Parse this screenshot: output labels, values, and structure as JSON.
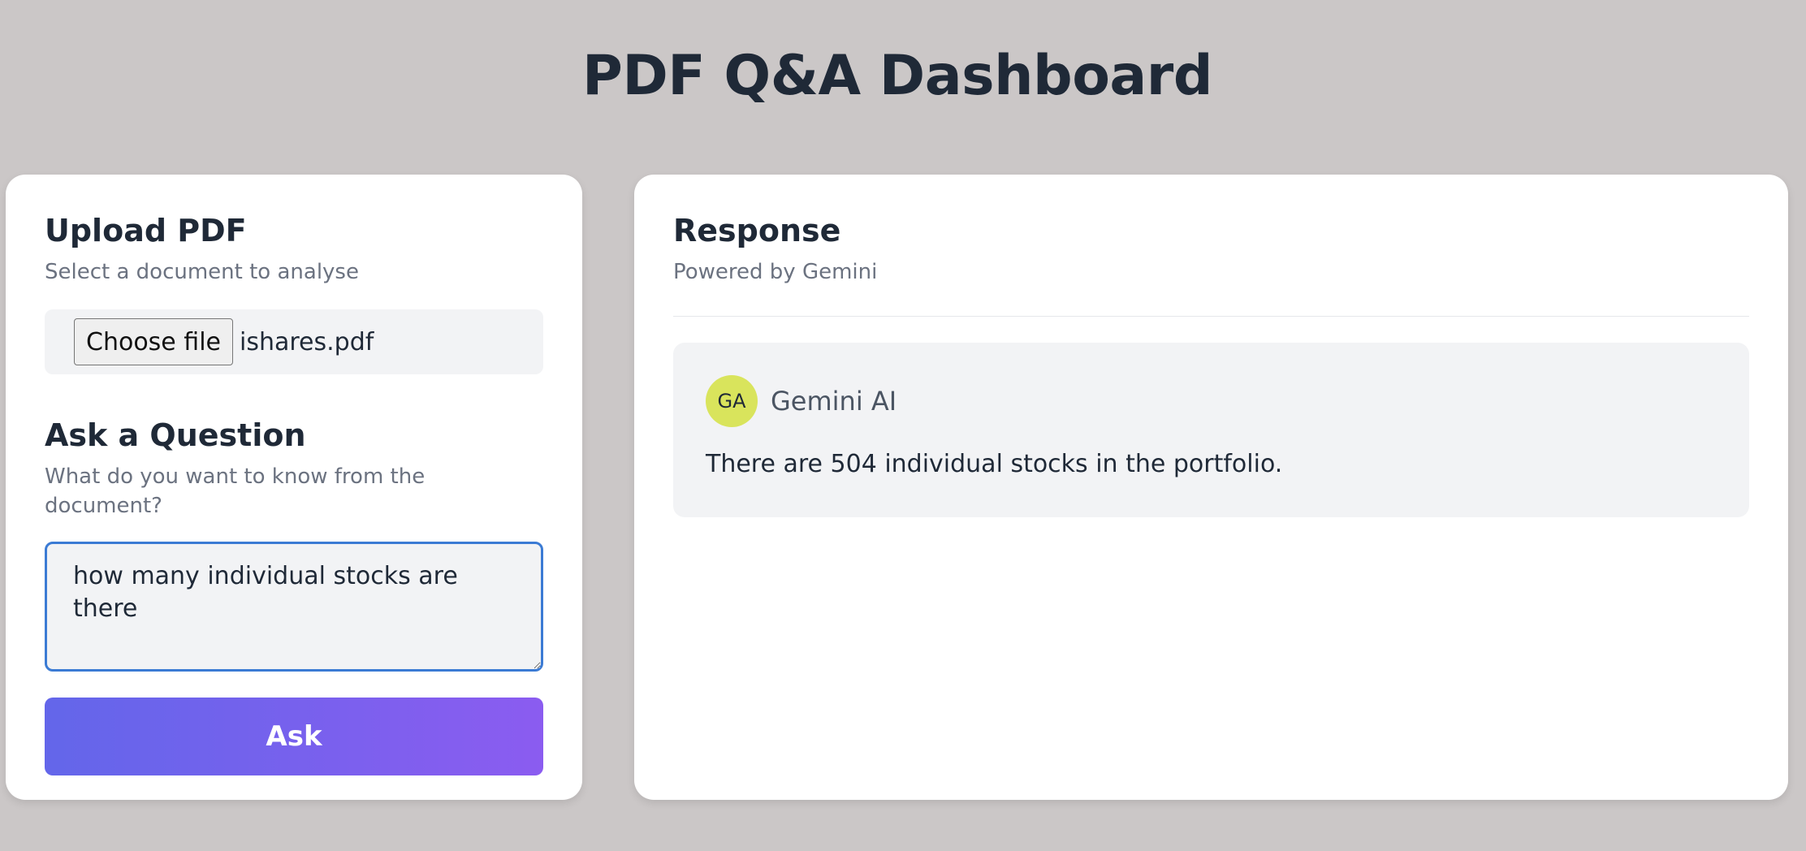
{
  "page": {
    "title": "PDF Q&A Dashboard"
  },
  "upload": {
    "title": "Upload PDF",
    "subtitle": "Select a document to analyse",
    "choose_file_label": "Choose file",
    "file_name": "ishares.pdf"
  },
  "question": {
    "title": "Ask a Question",
    "subtitle": "What do you want to know from the document?",
    "value": "how many individual stocks are there",
    "ask_label": "Ask"
  },
  "response": {
    "title": "Response",
    "subtitle": "Powered by Gemini",
    "message": {
      "avatar_initials": "GA",
      "sender": "Gemini AI",
      "text": "There are 504 individual stocks in the portfolio."
    }
  },
  "colors": {
    "background": "#cbc7c7",
    "accent_start": "#6366ea",
    "accent_end": "#8b5cf0",
    "avatar": "#d9e45c",
    "focus_border": "#3b7bd4"
  }
}
